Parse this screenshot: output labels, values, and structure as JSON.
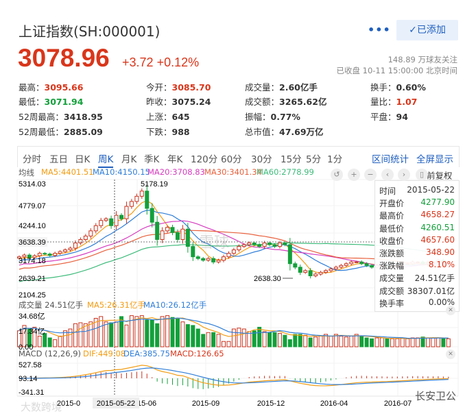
{
  "header": {
    "title": "上证指数(SH:000001)",
    "more_label": "•••",
    "added_button": "✓已添加",
    "price": "3078.96",
    "change": "+3.72",
    "change_pct": "+0.12%",
    "followers": "148.89 万球友关注",
    "status": "已收盘 10-11 15:00:00 北京时间"
  },
  "stats": [
    [
      {
        "label": "最高：",
        "value": "3095.66",
        "color": "red"
      },
      {
        "label": "今开：",
        "value": "3085.70",
        "color": "red"
      },
      {
        "label": "成交量：",
        "value": "2.60亿手"
      },
      {
        "label": "换手：",
        "value": "0.60%"
      }
    ],
    [
      {
        "label": "最低：",
        "value": "3071.94",
        "color": "green"
      },
      {
        "label": "昨收：",
        "value": "3075.24"
      },
      {
        "label": "成交额：",
        "value": "3265.62亿"
      },
      {
        "label": "量比：",
        "value": "1.07",
        "color": "red"
      }
    ],
    [
      {
        "label": "52周最高：",
        "value": "3418.95"
      },
      {
        "label": "上涨：",
        "value": "645"
      },
      {
        "label": "振幅：",
        "value": "0.77%"
      },
      {
        "label": "平盘：",
        "value": "94"
      }
    ],
    [
      {
        "label": "52周最低：",
        "value": "2885.09"
      },
      {
        "label": "下跌：",
        "value": "988"
      },
      {
        "label": "总市值：",
        "value": "47.69万亿"
      }
    ]
  ],
  "tabs": [
    "分时",
    "五日",
    "日K",
    "周K",
    "月K",
    "季K",
    "年K",
    "120分",
    "60分",
    "30分",
    "15分",
    "5分",
    "1分"
  ],
  "active_tab": "周K",
  "tab_actions": [
    "区间统计",
    "全屏显示"
  ],
  "ma_bar": {
    "label": "均线",
    "items": [
      {
        "text": "MA5:4401.51",
        "color": "#f39c12"
      },
      {
        "text": "MA10:4150.15",
        "color": "#2f7ed8"
      },
      {
        "text": "MA20:3708.83",
        "color": "#d63bbf"
      },
      {
        "text": "MA30:3401.34",
        "color": "#e8603c"
      },
      {
        "text": "MA60:2778.99",
        "color": "#3dbb7a"
      }
    ],
    "controls": [
      "↺",
      "+",
      "−",
      "‹",
      "›",
      "▯"
    ],
    "adjust_label": "前复权"
  },
  "colors": {
    "up": "#c8321e",
    "down": "#13a03b",
    "accent": "#1f5fbf"
  },
  "chart_data": {
    "type": "candlestick",
    "interval": "weekly",
    "price_axis_ticks": [
      "5314.03",
      "4779.07",
      "4244.10",
      "3638.39",
      "3174.18",
      "2639.21",
      "2104.25"
    ],
    "ylim": [
      2104.25,
      5314.03
    ],
    "crosshair_price": "3638.39",
    "high_label": "5178.19",
    "low_label": "2638.30",
    "closes": [
      3200,
      3250,
      3180,
      3230,
      3300,
      3280,
      3240,
      3300,
      3350,
      3400,
      3450,
      3600,
      3700,
      3800,
      3950,
      4100,
      4250,
      4300,
      4100,
      4400,
      4300,
      4658,
      4800,
      4950,
      5100,
      4600,
      4200,
      3700,
      3950,
      4050,
      3900,
      3700,
      4000,
      3500,
      3200,
      3150,
      3100,
      3150,
      3050,
      3100,
      3200,
      3300,
      3400,
      3500,
      3550,
      3600,
      3550,
      3500,
      3600,
      3550,
      3500,
      3600,
      3550,
      3000,
      2900,
      2750,
      2800,
      2650,
      2700,
      2750,
      2800,
      2850,
      2900,
      2950,
      3000,
      3050,
      3050,
      3000,
      2950,
      2900,
      2950,
      2950,
      2900,
      2950,
      2950,
      3000,
      3000,
      3050,
      3050,
      3000,
      3050,
      3050,
      3100,
      3050,
      3050
    ],
    "volumes": [
      18,
      24,
      20,
      22,
      12,
      15,
      10,
      8,
      12,
      18,
      20,
      26,
      27,
      26,
      28,
      32,
      34,
      28,
      27,
      28,
      34,
      24.51,
      35,
      34,
      35,
      30,
      30,
      26,
      34,
      35,
      33,
      32,
      28,
      25,
      24,
      20,
      14,
      16,
      16,
      14,
      6,
      6,
      20,
      21,
      20,
      17,
      18,
      22,
      17,
      16,
      16,
      15,
      13,
      8,
      14,
      14,
      13,
      10,
      11,
      12,
      14,
      12,
      14,
      12,
      11,
      12,
      14,
      12,
      10,
      9,
      10,
      10,
      9,
      9,
      9,
      10,
      9,
      10,
      10,
      11,
      10,
      10,
      10,
      9,
      9
    ],
    "volume_panel": {
      "label": "成交量 24.51亿手",
      "ma5": "MA5:26.31亿手",
      "ma10": "MA10:26.12亿手",
      "ticks": [
        "34.68亿",
        "17.34亿",
        "0.00"
      ]
    },
    "macd_panel": {
      "label": "MACD (12,26,9)",
      "dif": "DIF:449.08",
      "dea": "DEA:385.75",
      "macd": "MACD:126.65",
      "ticks": [
        "527.58",
        "93.14",
        "-341.31"
      ]
    },
    "x_ticks": [
      "2015-0",
      "15-06",
      "2015-09",
      "2015-12",
      "2016-04",
      "2016-07"
    ],
    "crosshair_date": "2015-05-22"
  },
  "tooltip": {
    "rows": [
      {
        "label": "时间",
        "value": "2015-05-22"
      },
      {
        "label": "开盘价",
        "value": "4277.90",
        "color": "green"
      },
      {
        "label": "最高价",
        "value": "4658.27",
        "color": "red"
      },
      {
        "label": "最低价",
        "value": "4260.51",
        "color": "green"
      },
      {
        "label": "收盘价",
        "value": "4657.60",
        "color": "red"
      },
      {
        "label": "涨跌额",
        "value": "348.90",
        "color": "red"
      },
      {
        "label": "涨跌幅",
        "value": "8.10%",
        "color": "red"
      },
      {
        "label": "成交量",
        "value": "24.51亿手"
      },
      {
        "label": "成交额",
        "value": "38307.01亿"
      },
      {
        "label": "换手率",
        "value": "0.00%"
      }
    ]
  },
  "watermarks": {
    "center": "雪球",
    "bottom_left": "大数跨境",
    "bottom_right": "长安卫公"
  }
}
